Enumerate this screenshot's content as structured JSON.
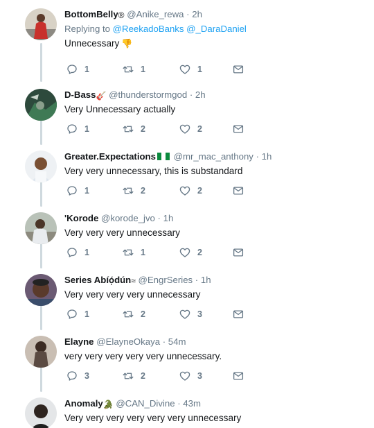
{
  "colors": {
    "accent": "#1da1f2",
    "muted": "#657786",
    "thread_line": "#cfd9de"
  },
  "icons": {
    "reply": "reply-icon",
    "retweet": "retweet-icon",
    "like": "heart-icon",
    "dm": "envelope-icon"
  },
  "replying_label": "Replying to",
  "tweets": [
    {
      "name": "BottomBelly",
      "badge": "®",
      "handle": "@Anike_rewa",
      "time": "2h",
      "replying_to": [
        "@ReekadoBanks",
        "@_DaraDaniel"
      ],
      "text": "Unnecessary",
      "text_emoji": "👎",
      "reply_count": "1",
      "retweet_count": "1",
      "like_count": "1"
    },
    {
      "name": "D-Bass",
      "badge": "🎸",
      "handle": "@thunderstormgod",
      "time": "2h",
      "text": "Very Unnecessary actually",
      "reply_count": "1",
      "retweet_count": "2",
      "like_count": "2"
    },
    {
      "name": "Greater.Expectations",
      "badge": "flag-ng",
      "handle": "@mr_mac_anthony",
      "time": "1h",
      "text": "Very very unnecessary, this is substandard",
      "reply_count": "1",
      "retweet_count": "2",
      "like_count": "2"
    },
    {
      "name": "'Korode",
      "badge": "",
      "handle": "@korode_jvo",
      "time": "1h",
      "text": "Very very very unnecessary",
      "reply_count": "1",
      "retweet_count": "1",
      "like_count": "2"
    },
    {
      "name": "Series Abíọ́dún",
      "badge": "≈",
      "handle": "@EngrSeries",
      "time": "1h",
      "text": "Very very very very unnecessary",
      "reply_count": "1",
      "retweet_count": "2",
      "like_count": "3"
    },
    {
      "name": "Elayne",
      "badge": "",
      "handle": "@ElayneOkaya",
      "time": "54m",
      "text": "very very very very very unnecessary.",
      "reply_count": "3",
      "retweet_count": "2",
      "like_count": "3"
    },
    {
      "name": "Anomaly",
      "badge": "🐊",
      "handle": "@CAN_Divine",
      "time": "43m",
      "text": "Very very very very very very unnecessary"
    }
  ]
}
